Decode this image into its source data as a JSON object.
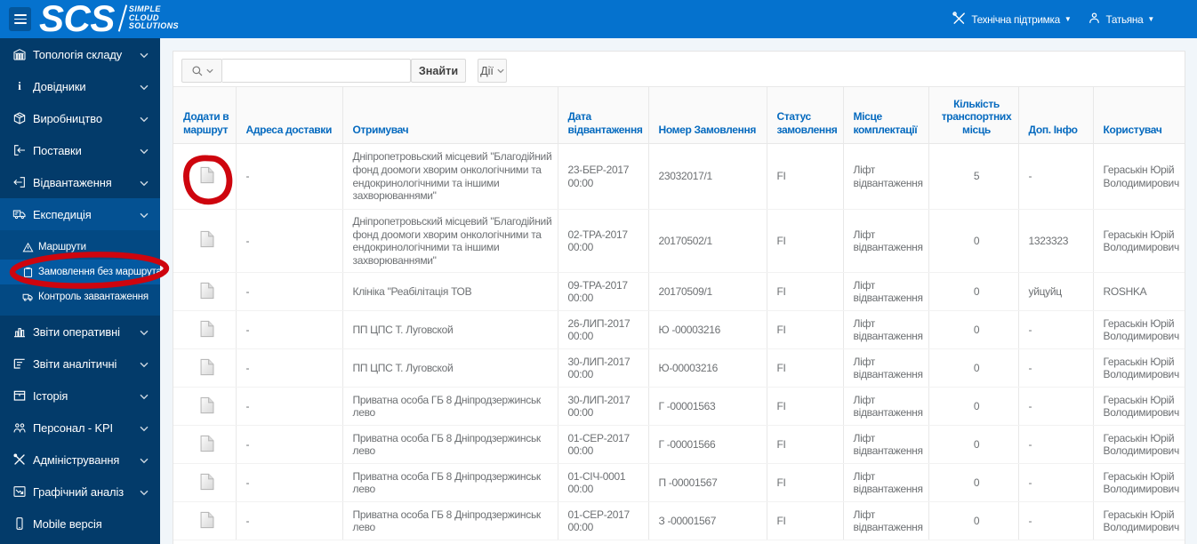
{
  "topbar": {
    "logo": "SCS",
    "logo_sub1": "SIMPLE",
    "logo_sub2": "CLOUD",
    "logo_sub3": "SOLUTIONS",
    "support": "Технічна підтримка",
    "user": "Татьяна"
  },
  "sidebar": {
    "items": [
      {
        "label": "Топологія складу"
      },
      {
        "label": "Довідники"
      },
      {
        "label": "Виробництво"
      },
      {
        "label": "Поставки"
      },
      {
        "label": "Відвантаження"
      },
      {
        "label": "Експедиція"
      },
      {
        "label": "Звіти оперативні"
      },
      {
        "label": "Звіти аналітичні"
      },
      {
        "label": "Історія"
      },
      {
        "label": "Персонал - KPI"
      },
      {
        "label": "Адміністрування"
      },
      {
        "label": "Графічний аналіз"
      },
      {
        "label": "Mobile версія"
      }
    ],
    "expedition_children": [
      {
        "label": "Маршрути"
      },
      {
        "label": "Замовлення без маршрута"
      },
      {
        "label": "Контроль завантаження"
      }
    ]
  },
  "search": {
    "input_value": "",
    "find": "Знайти",
    "actions": "Дії"
  },
  "table": {
    "headers": [
      "Додати в\nмаршрут",
      "Адреса доставки",
      "Отримувач",
      "Дата\nвідвантаження",
      "Номер Замовлення",
      "Статус\nзамовлення",
      "Місце\nкомплектації",
      "Кількість\nтранспортних\nмісць",
      "Доп. Інфо",
      "Користувач"
    ],
    "rows": [
      {
        "address": "-",
        "recipient": "Дніпропетровьский місцевий \"Благодійний\nфонд доомоги хворим онкологічними та\nендокринологічними та іншими\nзахворюваннями\"",
        "date": "23-БЕР-2017\n00:00",
        "order": "23032017/1",
        "status": "FI",
        "place": "Ліфт\nвідвантаження",
        "qty": "5",
        "info": "-",
        "user": "Гераськін Юрій\nВолодимирович"
      },
      {
        "address": "-",
        "recipient": "Дніпропетровьский місцевий \"Благодійний\nфонд доомоги хворим онкологічними та\nендокринологічними та іншими\nзахворюваннями\"",
        "date": "02-ТРА-2017\n00:00",
        "order": "20170502/1",
        "status": "FI",
        "place": "Ліфт\nвідвантаження",
        "qty": "0",
        "info": "1323323",
        "user": "Гераськін Юрій\nВолодимирович"
      },
      {
        "address": "-",
        "recipient": "Клініка \"Реабілітація ТОВ",
        "date": "09-ТРА-2017\n00:00",
        "order": "20170509/1",
        "status": "FI",
        "place": "Ліфт\nвідвантаження",
        "qty": "0",
        "info": "уйцуйц",
        "user": "ROSHKA"
      },
      {
        "address": "-",
        "recipient": "ПП ЦПС Т. Луговской",
        "date": "26-ЛИП-2017\n00:00",
        "order": "Ю -00003216",
        "status": "FI",
        "place": "Ліфт\nвідвантаження",
        "qty": "0",
        "info": "-",
        "user": "Гераськін Юрій\nВолодимирович"
      },
      {
        "address": "-",
        "recipient": "ПП ЦПС Т. Луговской",
        "date": "30-ЛИП-2017\n00:00",
        "order": "Ю-00003216",
        "status": "FI",
        "place": "Ліфт\nвідвантаження",
        "qty": "0",
        "info": "-",
        "user": "Гераськін Юрій\nВолодимирович"
      },
      {
        "address": "-",
        "recipient": "Приватна особа ГБ 8 Дніпродзержинськ\nлево",
        "date": "30-ЛИП-2017\n00:00",
        "order": "Г -00001563",
        "status": "FI",
        "place": "Ліфт\nвідвантаження",
        "qty": "0",
        "info": "-",
        "user": "Гераськін Юрій\nВолодимирович"
      },
      {
        "address": "-",
        "recipient": "Приватна особа ГБ 8 Дніпродзержинськ\nлево",
        "date": "01-СЕР-2017\n00:00",
        "order": "Г -00001566",
        "status": "FI",
        "place": "Ліфт\nвідвантаження",
        "qty": "0",
        "info": "-",
        "user": "Гераськін Юрій\nВолодимирович"
      },
      {
        "address": "-",
        "recipient": "Приватна особа ГБ 8 Дніпродзержинськ\nлево",
        "date": "01-СІЧ-0001\n00:00",
        "order": "П -00001567",
        "status": "FI",
        "place": "Ліфт\nвідвантаження",
        "qty": "0",
        "info": "-",
        "user": "Гераськін Юрій\nВолодимирович"
      },
      {
        "address": "-",
        "recipient": "Приватна особа ГБ 8 Дніпродзержинськ\nлево",
        "date": "01-СЕР-2017\n00:00",
        "order": "З -00001567",
        "status": "FI",
        "place": "Ліфт\nвідвантаження",
        "qty": "0",
        "info": "-",
        "user": "Гераськін Юрій\nВолодимирович"
      }
    ]
  }
}
